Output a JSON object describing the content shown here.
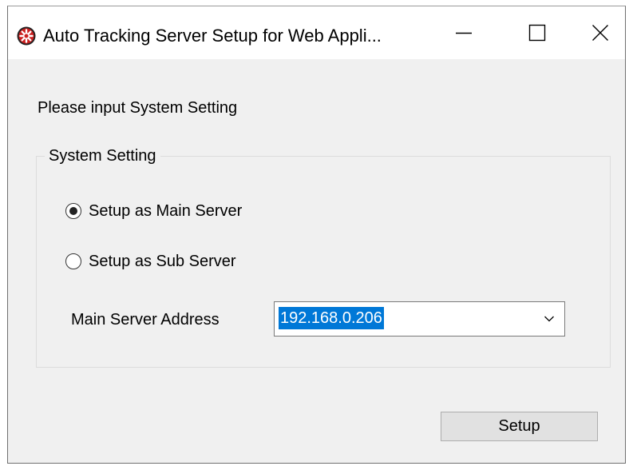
{
  "window": {
    "title": "Auto Tracking Server Setup for Web Appli...",
    "app_icon": "red-wheel-icon",
    "controls": {
      "minimize": "minimize-icon",
      "maximize": "maximize-icon",
      "close": "close-icon"
    }
  },
  "main": {
    "prompt": "Please input System Setting",
    "group": {
      "title": "System Setting",
      "options": [
        {
          "label": "Setup as Main Server",
          "selected": true
        },
        {
          "label": "Setup as Sub Server",
          "selected": false
        }
      ],
      "address": {
        "label": "Main Server Address",
        "value": "192.168.0.206",
        "selected_text": true
      }
    },
    "setup_button": "Setup"
  },
  "colors": {
    "window_bg": "#f0f0f0",
    "titlebar_bg": "#ffffff",
    "selection": "#0078d7",
    "icon_red": "#cc1f1f",
    "button_bg": "#e1e1e1"
  }
}
